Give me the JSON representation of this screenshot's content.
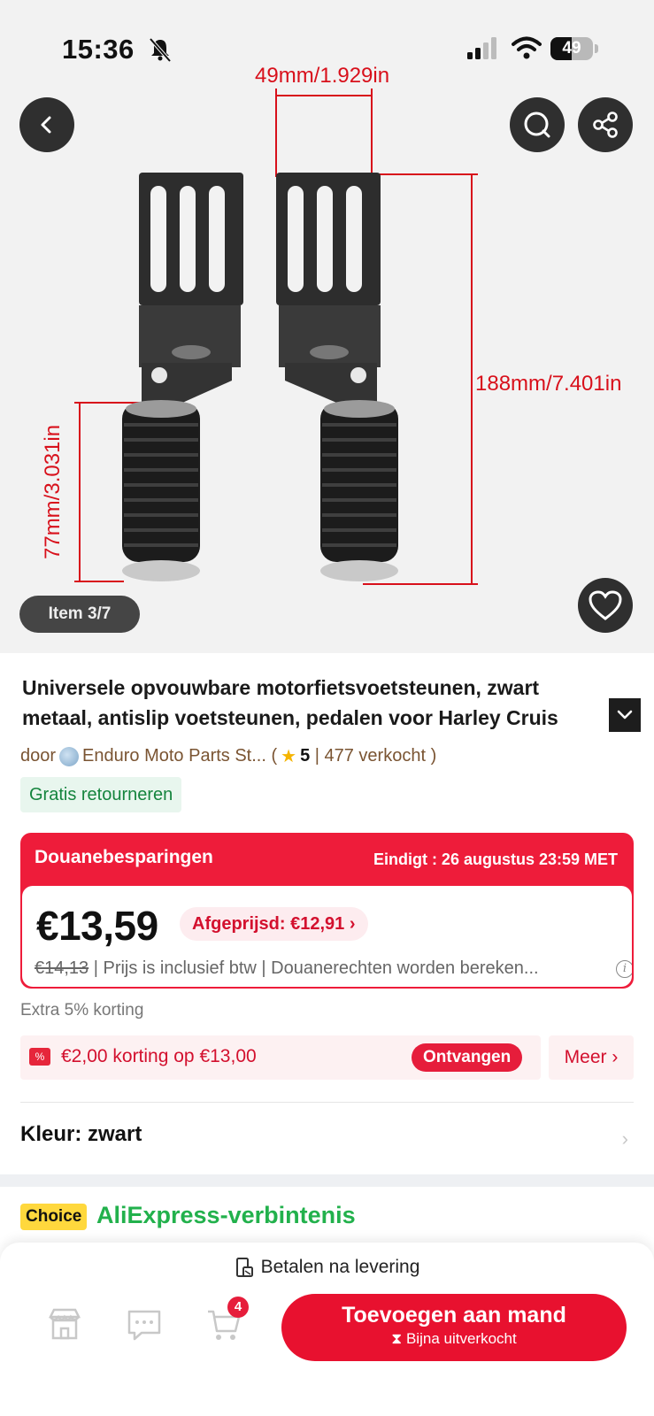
{
  "status_bar": {
    "time": "15:36",
    "battery": "49",
    "battery_level": 0.49
  },
  "hero": {
    "dimensions": {
      "width_label": "49mm/1.929in",
      "height_label": "188mm/7.401in",
      "grip_label": "77mm/3.031in"
    },
    "item_counter": "Item 3/7",
    "icons": [
      "back-icon",
      "search-icon",
      "share-icon",
      "heart-icon"
    ]
  },
  "product": {
    "title_line1": "Universele opvouwbare motorfietsvoetsteunen, zwart",
    "title_line2": "metaal, antislip voetsteunen, pedalen voor Harley Cruis",
    "seller_prefix": "door",
    "seller_name": "Enduro Moto Parts St...",
    "rating": "5",
    "sold": "477 verkocht",
    "free_return": "Gratis retourneren"
  },
  "customs": {
    "title": "Douanebesparingen",
    "ends": "Eindigt : 26 augustus 23:59 MET",
    "price": "€13,59",
    "reduced": "Afgeprijsd: €12,91",
    "old_price": "€14,13",
    "info": "| Prijs is inclusief btw | Douanerechten worden bereken..."
  },
  "extra_discount": "Extra 5% korting",
  "coupon": {
    "text": "€2,00 korting op €13,00",
    "button": "Ontvangen",
    "more": "Meer"
  },
  "color": {
    "label": "Kleur: zwart"
  },
  "choice": {
    "badge": "Choice",
    "text": "AliExpress-verbintenis"
  },
  "bottom": {
    "pay_after_delivery": "Betalen na levering",
    "cart_count": "4",
    "add_to_cart": "Toevoegen aan mand",
    "stock_note": "Bijna uitverkocht"
  },
  "colors": {
    "accent": "#e8112f",
    "green": "#22b14c",
    "dimension_red": "#d8101b"
  }
}
